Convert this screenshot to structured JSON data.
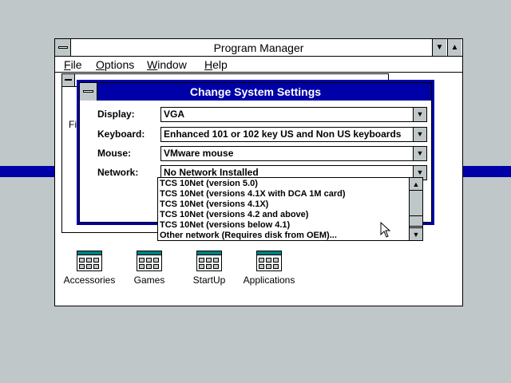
{
  "program_manager": {
    "title": "Program Manager",
    "menu": [
      "File",
      "Options",
      "Window",
      "Help"
    ],
    "partial_text": "Fil"
  },
  "program_groups": [
    {
      "label": "Accessories"
    },
    {
      "label": "Games"
    },
    {
      "label": "StartUp"
    },
    {
      "label": "Applications"
    }
  ],
  "dialog": {
    "title": "Change System Settings",
    "fields": [
      {
        "label": "Display:",
        "value": "VGA"
      },
      {
        "label": "Keyboard:",
        "value": "Enhanced 101 or 102 key US and Non US keyboards"
      },
      {
        "label": "Mouse:",
        "value": "VMware mouse"
      },
      {
        "label": "Network:",
        "value": "No Network Installed"
      }
    ],
    "network_options": [
      "TCS 10Net (version 5.0)",
      "TCS 10Net (versions 4.1X with DCA 1M card)",
      "TCS 10Net (versions 4.1X)",
      "TCS 10Net (versions 4.2 and above)",
      "TCS 10Net (versions below 4.1)",
      "Other network (Requires disk from OEM)..."
    ]
  },
  "colors": {
    "desktop": "#c0c7c8",
    "active_title": "#0000a8",
    "window": "#ffffff"
  }
}
